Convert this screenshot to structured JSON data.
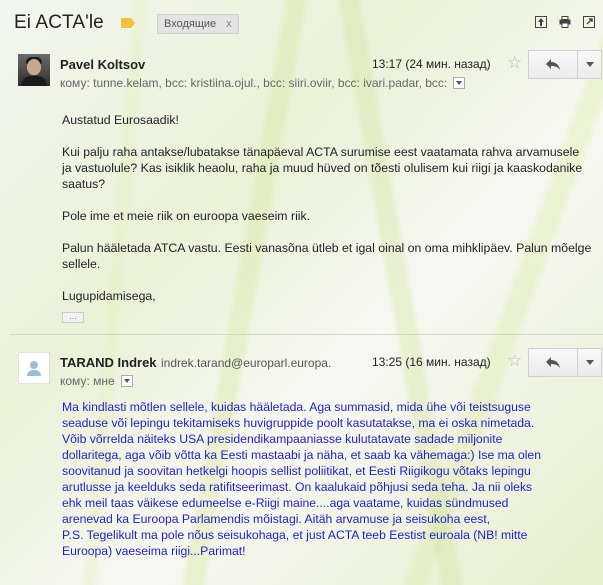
{
  "header": {
    "subject": "Ei ACTA'le",
    "label": "Входящие",
    "label_close": "x",
    "icons": [
      "archive-icon",
      "print-icon",
      "new-window-icon"
    ]
  },
  "messages": [
    {
      "sender": "Pavel Koltsov",
      "to_line": "кому: tunne.kelam, bcc: kristiina.ojul., bcc: siiri.oviir, bcc: ivari.padar, bcc:",
      "time": "13:17 (24 мин. назад)",
      "body": [
        "Austatud Eurosaadik!",
        "Kui palju raha antakse/lubatakse tänapäeval ACTA surumise eest vaatamata rahva arvamusele ja vastuolule? Kas isiklik heaolu, raha ja muud hüved on tõesti olulisem kui riigi ja kaaskodanike saatus?",
        "Pole ime et meie riik on euroopa vaeseim riik.",
        "Palun hääletada ATCA vastu. Eesti vanasõna ütleb et igal oinal on oma mihklipäev. Palun mõelge sellele.",
        "Lugupidamisega,"
      ],
      "ellipsis": "..."
    },
    {
      "sender": "TARAND Indrek",
      "sender_email": "indrek.tarand@europarl.europa.",
      "to_line": "кому: мне",
      "time": "13:25 (16 мин. назад)",
      "body_lines": [
        "Ma kindlasti mõtlen sellele, kuidas hääletada.  Aga summasid, mida ühe või teistsuguse",
        "seaduse või lepingu tekitamiseks huvigruppide poolt kasutatakse, ma ei oska nimetada.",
        "Võib võrrelda näiteks USA presidendikampaaniasse kulutatavate sadade miljonite",
        "dollaritega, aga võib võtta ka Eesti mastaabi ja näha, et saab ka vähemaga:)  Ise ma olen",
        "soovitanud ja soovitan hetkelgi hoopis sellist poliitikat, et Eesti Riigikogu võtaks lepingu",
        "arutlusse ja keelduks seda ratifitseerimast.  On kaalukaid põhjusi seda teha.  Ja nii oleks",
        "ehk meil taas väikese edumeelse e-Riigi maine....aga vaatame, kuidas sündmused",
        "arenevad ka Euroopa Parlamendis mõistagi. Aitäh arvamuse ja seisukoha eest,",
        "P.S. Tegelikult ma pole nõus seisukohaga, et just ACTA teeb Eestist euroala (NB! mitte",
        "Euroopa) vaeseima riigi...Parimat!"
      ]
    }
  ],
  "colors": {
    "quoted_text": "#1f1fcc",
    "background_theme": "#eaf2d8"
  }
}
